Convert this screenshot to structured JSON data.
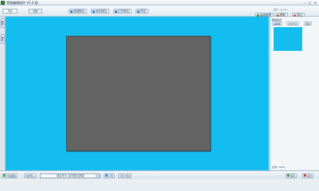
{
  "window": {
    "title": "草图编辑软件 V1.0 版",
    "controls": "– □ ×"
  },
  "toolbar": {
    "tabs": [
      "开始",
      "帮助"
    ],
    "buttons": [
      {
        "label": "新建报名",
        "color": "#2f7fc8"
      },
      {
        "label": "保存报名",
        "color": "#2f7fc8"
      },
      {
        "label": "打开报名",
        "color": "#2f7fc8"
      },
      {
        "label": "预览",
        "color": "#2f7fc8"
      }
    ],
    "right_info": "用户: admin",
    "right_buttons": [
      {
        "label": "高级管理",
        "color": "#3a9b3a"
      },
      {
        "label": "帮助",
        "color": "#c8472f"
      },
      {
        "label": "退出",
        "color": "#c8472f"
      }
    ]
  },
  "left_strip": {
    "tabs": [
      "图层",
      "属性"
    ]
  },
  "canvas": {
    "background": "#14bdf0",
    "page_color": "#646464"
  },
  "right_panel": {
    "title": "图像缩览",
    "tabs": [
      "缩略图",
      "对象列表",
      "图层"
    ],
    "bottom_text": "比例: 100%"
  },
  "statusbar": {
    "left_buttons": [
      "高级面板",
      "请求导入"
    ],
    "select_value": "报名样式 (合同报名表单)",
    "mid_buttons": [
      "打印",
      "打印·测试"
    ],
    "right_buttons": [
      "保存",
      "退出"
    ]
  }
}
